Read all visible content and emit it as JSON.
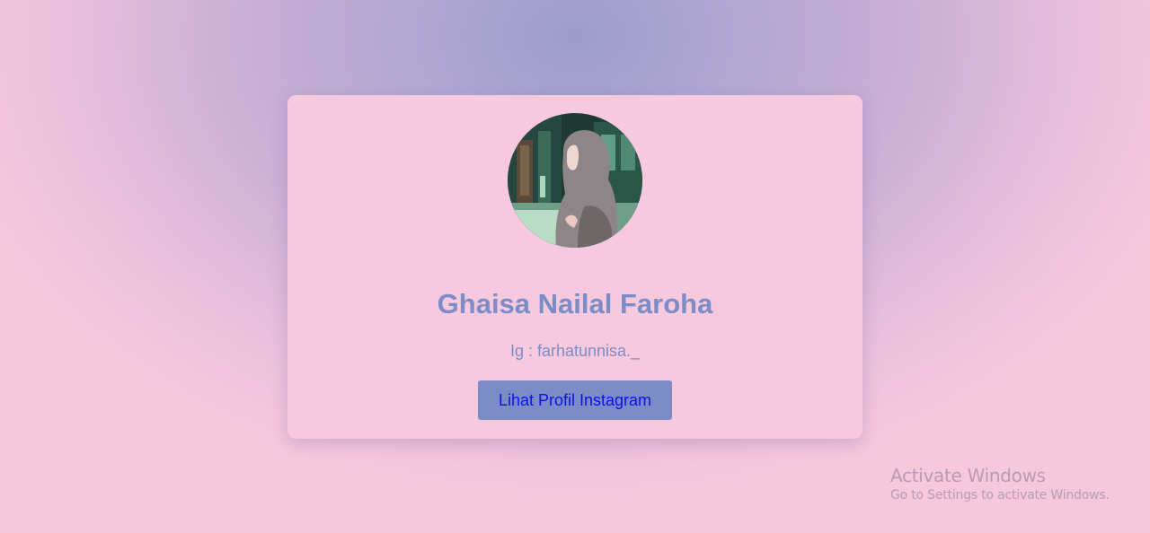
{
  "profile": {
    "name": "Ghaisa Nailal Faroha",
    "handle": "Ig : farhatunnisa._",
    "button_label": "Lihat Profil Instagram",
    "avatar_icon": "profile-photo"
  },
  "watermark": {
    "title": "Activate Windows",
    "subtitle": "Go to Settings to activate Windows."
  },
  "colors": {
    "card_background": "#f6c9de",
    "accent": "#7b8cc6",
    "button_text": "#0d10ee",
    "page_center": "#9c9ccc",
    "page_edge": "#f6c8dc"
  }
}
